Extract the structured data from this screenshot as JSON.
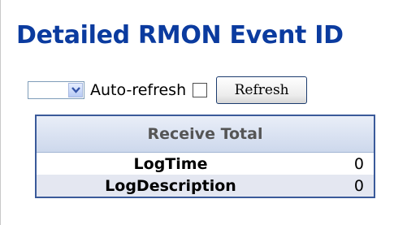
{
  "page": {
    "title": "Detailed RMON Event  ID"
  },
  "controls": {
    "refresh_select_value": "",
    "auto_refresh_label": "Auto-refresh",
    "auto_refresh_checked": false,
    "refresh_button_label": "Refresh"
  },
  "table": {
    "header": "Receive Total",
    "rows": [
      {
        "label": "LogTime",
        "value": "0"
      },
      {
        "label": "LogDescription",
        "value": "0"
      }
    ]
  },
  "colors": {
    "title": "#0b3b9f",
    "table_border": "#3a5a9a",
    "header_bg": "#cdd8ec",
    "alt_row_bg": "#e4e7f1"
  },
  "icons": [
    "chevron-down-icon"
  ]
}
